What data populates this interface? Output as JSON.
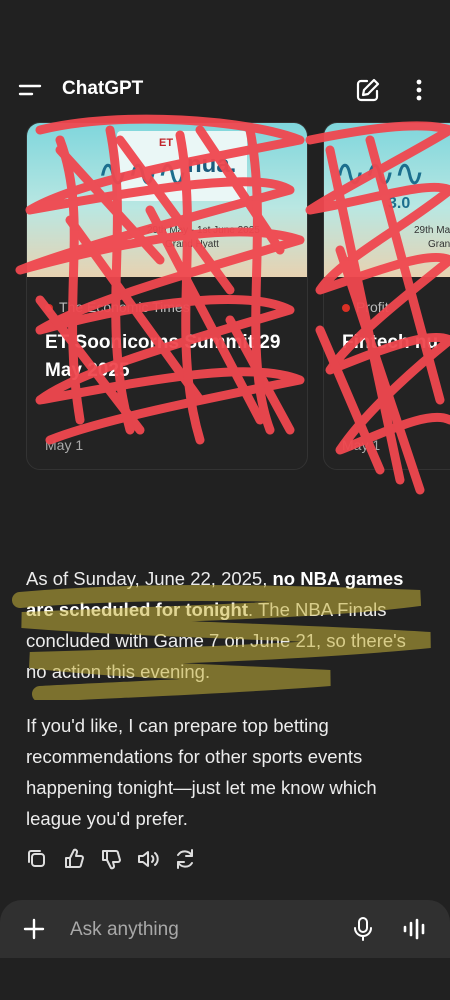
{
  "header": {
    "title": "ChatGPT",
    "icons": [
      "menu-icon",
      "edit-icon",
      "more-vertical-icon"
    ]
  },
  "cards": [
    {
      "image_et": "ET",
      "image_brand": "nua.",
      "image_version": "3.0",
      "image_date": "29th May - 1st June 2025",
      "image_venue": "Grand Hyatt",
      "source": "The Economic Times",
      "headline": "ET Soonicorns Summit 29 May 2025",
      "meta": "May 1"
    },
    {
      "image_et": "",
      "image_brand": "",
      "image_version": "3.0",
      "image_date": "29th May",
      "image_venue": "Gran",
      "source": "Profit",
      "headline": "Fintech nu",
      "meta": "May 1"
    }
  ],
  "message": {
    "p1_pre": "As of Sunday, June 22, 2025, ",
    "p1_bold": "no NBA games are scheduled for tonight",
    "p1_post": ". The NBA Finals concluded with Game 7 on June 21, so there's no action this evening.",
    "p2": "If you'd like, I can prepare top betting recommendations for other sports events happening tonight—just let me know which league you'd prefer."
  },
  "actions": [
    "copy-icon",
    "thumbs-up-icon",
    "thumbs-down-icon",
    "read-aloud-icon",
    "regenerate-icon"
  ],
  "composer": {
    "placeholder": "Ask anything"
  },
  "colors": {
    "background": "#212121",
    "composer": "#303030",
    "scribble": "#f0474f",
    "highlight": "#c9b43a"
  }
}
